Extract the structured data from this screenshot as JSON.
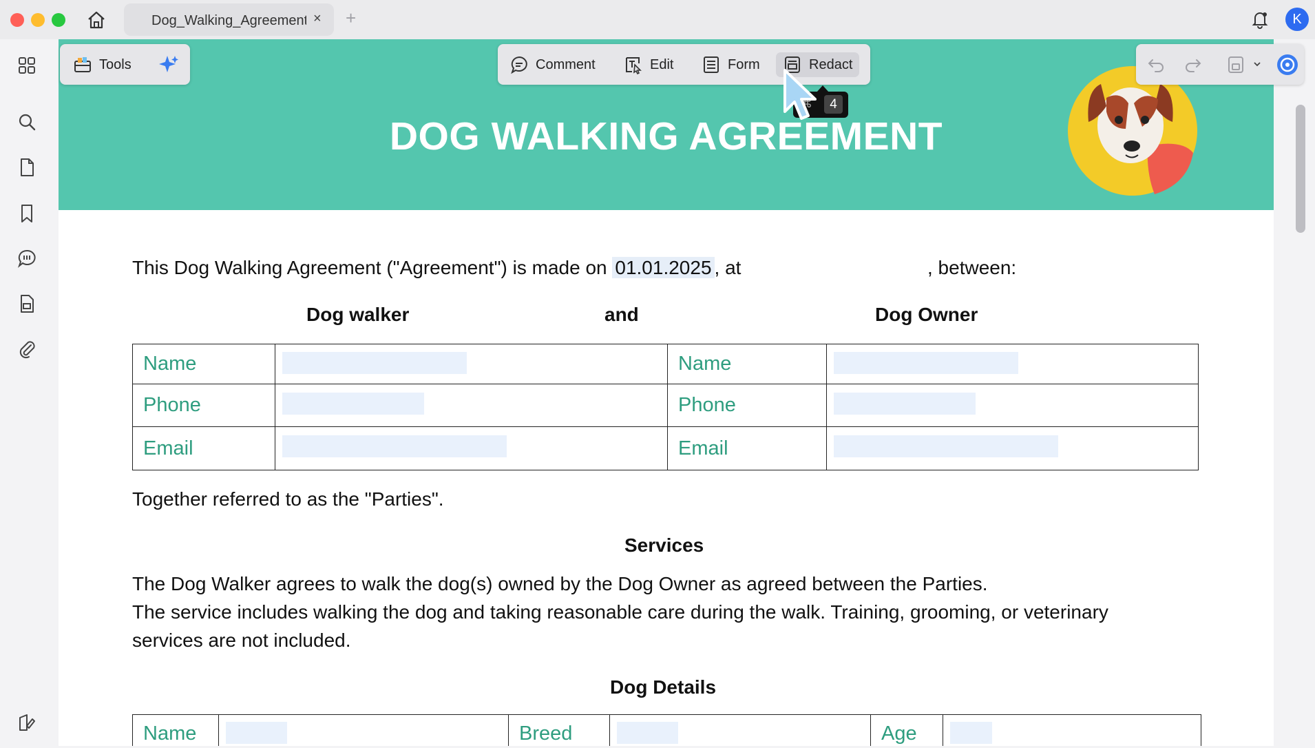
{
  "window": {
    "tab_title": "Dog_Walking_Agreement",
    "tab_close": "×",
    "tab_add": "+",
    "avatar_letter": "K"
  },
  "toolbar": {
    "tools_label": "Tools",
    "comment_label": "Comment",
    "edit_label": "Edit",
    "form_label": "Form",
    "redact_label": "Redact",
    "tooltip_key": "4",
    "tooltip_modifier": "⌘"
  },
  "icons": {
    "home": "home-icon",
    "bell": "bell-icon",
    "sidebar": [
      "grid-icon",
      "search-icon",
      "page-icon",
      "bookmark-icon",
      "comment-icon",
      "stamp-icon",
      "attachment-icon",
      "sign-icon"
    ],
    "undo": "undo-icon",
    "redo": "redo-icon",
    "save": "save-icon",
    "ai": "ai-assistant-icon"
  },
  "document": {
    "title": "DOG WALKING AGREEMENT",
    "intro_before": "This Dog Walking Agreement (\"Agreement\") is made on ",
    "intro_date": "01.01.2025",
    "intro_at": ", at",
    "intro_between": ", between:",
    "party_walker": "Dog walker",
    "party_and": "and",
    "party_owner": "Dog Owner",
    "party_table": [
      {
        "label_left": "Name",
        "label_right": "Name"
      },
      {
        "label_left": "Phone",
        "label_right": "Phone"
      },
      {
        "label_left": "Email",
        "label_right": "Email"
      }
    ],
    "together": "Together referred to as the \"Parties\".",
    "services_heading": "Services",
    "services_line1": "The Dog Walker agrees to walk the dog(s) owned by the Dog Owner as agreed between the Parties.",
    "services_line2": "The service includes walking the dog and taking reasonable care during the walk. Training, grooming, or veterinary",
    "services_line3": "services are not included.",
    "dog_details_heading": "Dog Details",
    "dog_table": {
      "name": "Name",
      "breed": "Breed",
      "age": "Age"
    }
  },
  "colors": {
    "banner": "#54c6ae",
    "field_label": "#2e9d7f",
    "field_fill": "#e9f1fc"
  }
}
